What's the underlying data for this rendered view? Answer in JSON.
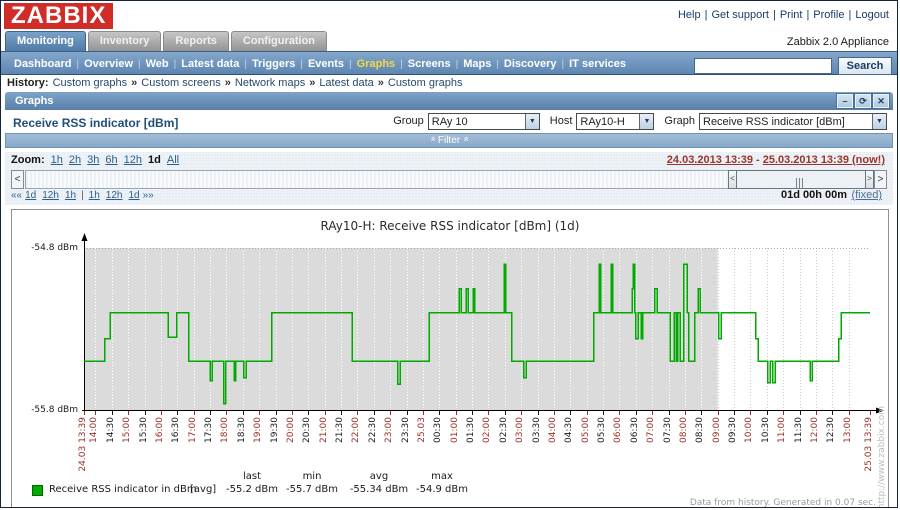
{
  "header": {
    "logo": "ZABBIX",
    "links": [
      "Help",
      "Get support",
      "Print",
      "Profile",
      "Logout"
    ],
    "appliance": "Zabbix 2.0 Appliance"
  },
  "tabs": {
    "items": [
      "Monitoring",
      "Inventory",
      "Reports",
      "Configuration"
    ],
    "active": "Monitoring"
  },
  "subnav": {
    "items": [
      "Dashboard",
      "Overview",
      "Web",
      "Latest data",
      "Triggers",
      "Events",
      "Graphs",
      "Screens",
      "Maps",
      "Discovery",
      "IT services"
    ],
    "active": "Graphs",
    "search_button": "Search"
  },
  "history": {
    "label": "History:",
    "separator": "»",
    "items": [
      "Custom graphs",
      "Custom screens",
      "Network maps",
      "Latest data",
      "Custom graphs"
    ]
  },
  "widget": {
    "title": "Graphs",
    "window_buttons": [
      {
        "name": "minimize",
        "glyph": "–"
      },
      {
        "name": "restore",
        "glyph": "⟳"
      },
      {
        "name": "close",
        "glyph": "✕"
      }
    ],
    "page_title": "Receive RSS indicator [dBm]",
    "selectors": [
      {
        "label": "Group",
        "value": "RAy 10"
      },
      {
        "label": "Host",
        "value": "RAy10-H"
      },
      {
        "label": "Graph",
        "value": "Receive RSS indicator [dBm]"
      }
    ],
    "filter_label": "Filter",
    "chevron_glyph": "»"
  },
  "timebar": {
    "zoom_label": "Zoom:",
    "zoom_links": [
      "1h",
      "2h",
      "3h",
      "6h",
      "12h"
    ],
    "zoom_active": "1d",
    "zoom_all": "All",
    "date_from": "24.03.2013 13:39",
    "date_separator": "-",
    "date_to": "25.03.2013 13:39 (now!)",
    "left_arrow": "<",
    "right_arrow": ">",
    "nav_prev_label": "««",
    "nav_next_label": "»»",
    "nav_left": [
      "1d",
      "12h",
      "1h"
    ],
    "nav_divider": "|",
    "nav_right": [
      "1h",
      "12h",
      "1d"
    ],
    "period": "01d 00h 00m",
    "fixed_link": "(fixed)"
  },
  "chart_data": {
    "type": "line",
    "title": "RAy10-H: Receive RSS indicator [dBm] (1d)",
    "ylabel_top": "-54.8 dBm",
    "ylabel_bottom": "-55.8 dBm",
    "ylim": [
      -55.8,
      -54.8
    ],
    "x_range_minutes": 1440,
    "work_start_minute": 1161,
    "grid": true,
    "legend_position": "bottom",
    "legend_headers": [
      "last",
      "min",
      "avg",
      "max"
    ],
    "x_ticks": [
      {
        "label": "24.03 13:39",
        "min": 0,
        "red": true
      },
      {
        "label": "14:00",
        "min": 21,
        "red": true
      },
      {
        "label": "14:30",
        "min": 51,
        "red": false
      },
      {
        "label": "15:00",
        "min": 81,
        "red": true
      },
      {
        "label": "15:30",
        "min": 111,
        "red": false
      },
      {
        "label": "16:00",
        "min": 141,
        "red": true
      },
      {
        "label": "16:30",
        "min": 171,
        "red": false
      },
      {
        "label": "17:00",
        "min": 201,
        "red": true
      },
      {
        "label": "17:30",
        "min": 231,
        "red": false
      },
      {
        "label": "18:00",
        "min": 261,
        "red": true
      },
      {
        "label": "18:30",
        "min": 291,
        "red": false
      },
      {
        "label": "19:00",
        "min": 321,
        "red": true
      },
      {
        "label": "19:30",
        "min": 351,
        "red": false
      },
      {
        "label": "20:00",
        "min": 381,
        "red": true
      },
      {
        "label": "20:30",
        "min": 411,
        "red": false
      },
      {
        "label": "21:00",
        "min": 441,
        "red": true
      },
      {
        "label": "21:30",
        "min": 471,
        "red": false
      },
      {
        "label": "22:00",
        "min": 501,
        "red": true
      },
      {
        "label": "22:30",
        "min": 531,
        "red": false
      },
      {
        "label": "23:00",
        "min": 561,
        "red": true
      },
      {
        "label": "23:30",
        "min": 591,
        "red": false
      },
      {
        "label": "25.03",
        "min": 621,
        "red": true
      },
      {
        "label": "00:30",
        "min": 651,
        "red": false
      },
      {
        "label": "01:00",
        "min": 681,
        "red": true
      },
      {
        "label": "01:30",
        "min": 711,
        "red": false
      },
      {
        "label": "02:00",
        "min": 741,
        "red": true
      },
      {
        "label": "02:30",
        "min": 771,
        "red": false
      },
      {
        "label": "03:00",
        "min": 801,
        "red": true
      },
      {
        "label": "03:30",
        "min": 831,
        "red": false
      },
      {
        "label": "04:00",
        "min": 861,
        "red": true
      },
      {
        "label": "04:30",
        "min": 891,
        "red": false
      },
      {
        "label": "05:00",
        "min": 921,
        "red": true
      },
      {
        "label": "05:30",
        "min": 951,
        "red": false
      },
      {
        "label": "06:00",
        "min": 981,
        "red": true
      },
      {
        "label": "06:30",
        "min": 1011,
        "red": false
      },
      {
        "label": "07:00",
        "min": 1041,
        "red": true
      },
      {
        "label": "07:30",
        "min": 1071,
        "red": false
      },
      {
        "label": "08:00",
        "min": 1101,
        "red": true
      },
      {
        "label": "08:30",
        "min": 1131,
        "red": false
      },
      {
        "label": "09:00",
        "min": 1161,
        "red": true
      },
      {
        "label": "09:30",
        "min": 1191,
        "red": false
      },
      {
        "label": "10:00",
        "min": 1221,
        "red": true
      },
      {
        "label": "10:30",
        "min": 1251,
        "red": false
      },
      {
        "label": "11:00",
        "min": 1281,
        "red": true
      },
      {
        "label": "11:30",
        "min": 1311,
        "red": false
      },
      {
        "label": "12:00",
        "min": 1341,
        "red": true
      },
      {
        "label": "12:30",
        "min": 1371,
        "red": false
      },
      {
        "label": "13:00",
        "min": 1401,
        "red": true
      },
      {
        "label": "25.03 13:39",
        "min": 1440,
        "red": true
      }
    ],
    "series": [
      {
        "name": "Receive RSS indicator in dBm",
        "agg": "[avg]",
        "color": "#00AA00",
        "stats": {
          "last": "-55.2 dBm",
          "min": "-55.7 dBm",
          "avg": "-55.34 dBm",
          "max": "-54.9 dBm"
        },
        "points_min_dbm": [
          [
            0,
            -55.5
          ],
          [
            38,
            -55.36
          ],
          [
            48,
            -55.2
          ],
          [
            154,
            -55.35
          ],
          [
            170,
            -55.2
          ],
          [
            192,
            -55.5
          ],
          [
            231,
            -55.62
          ],
          [
            235,
            -55.5
          ],
          [
            256,
            -55.76
          ],
          [
            260,
            -55.5
          ],
          [
            275,
            -55.62
          ],
          [
            278,
            -55.5
          ],
          [
            293,
            -55.6
          ],
          [
            297,
            -55.5
          ],
          [
            344,
            -55.2
          ],
          [
            491,
            -55.5
          ],
          [
            575,
            -55.64
          ],
          [
            579,
            -55.5
          ],
          [
            632,
            -55.2
          ],
          [
            687,
            -55.05
          ],
          [
            691,
            -55.2
          ],
          [
            700,
            -55.05
          ],
          [
            704,
            -55.2
          ],
          [
            713,
            -55.05
          ],
          [
            716,
            -55.2
          ],
          [
            770,
            -54.9
          ],
          [
            773,
            -55.2
          ],
          [
            784,
            -55.5
          ],
          [
            806,
            -55.6
          ],
          [
            810,
            -55.5
          ],
          [
            934,
            -55.2
          ],
          [
            944,
            -54.9
          ],
          [
            947,
            -55.2
          ],
          [
            966,
            -54.9
          ],
          [
            969,
            -55.2
          ],
          [
            1004,
            -55.05
          ],
          [
            1006,
            -54.9
          ],
          [
            1009,
            -55.2
          ],
          [
            1011,
            -55.36
          ],
          [
            1015,
            -55.2
          ],
          [
            1021,
            -55.36
          ],
          [
            1024,
            -55.2
          ],
          [
            1046,
            -55.05
          ],
          [
            1050,
            -55.2
          ],
          [
            1074,
            -55.5
          ],
          [
            1081,
            -55.2
          ],
          [
            1085,
            -55.5
          ],
          [
            1088,
            -55.2
          ],
          [
            1092,
            -55.5
          ],
          [
            1099,
            -54.9
          ],
          [
            1105,
            -55.2
          ],
          [
            1108,
            -55.5
          ],
          [
            1119,
            -55.2
          ],
          [
            1125,
            -55.05
          ],
          [
            1129,
            -55.2
          ],
          [
            1163,
            -55.36
          ],
          [
            1167,
            -55.2
          ],
          [
            1231,
            -55.36
          ],
          [
            1235,
            -55.5
          ],
          [
            1253,
            -55.63
          ],
          [
            1257,
            -55.5
          ],
          [
            1262,
            -55.63
          ],
          [
            1266,
            -55.5
          ],
          [
            1330,
            -55.62
          ],
          [
            1334,
            -55.5
          ],
          [
            1383,
            -55.36
          ],
          [
            1387,
            -55.2
          ],
          [
            1440,
            -55.2
          ]
        ]
      }
    ]
  },
  "footer": {
    "generated": "Data from history. Generated in 0.07 sec.",
    "watermark": "http://www.zabbix.com"
  }
}
